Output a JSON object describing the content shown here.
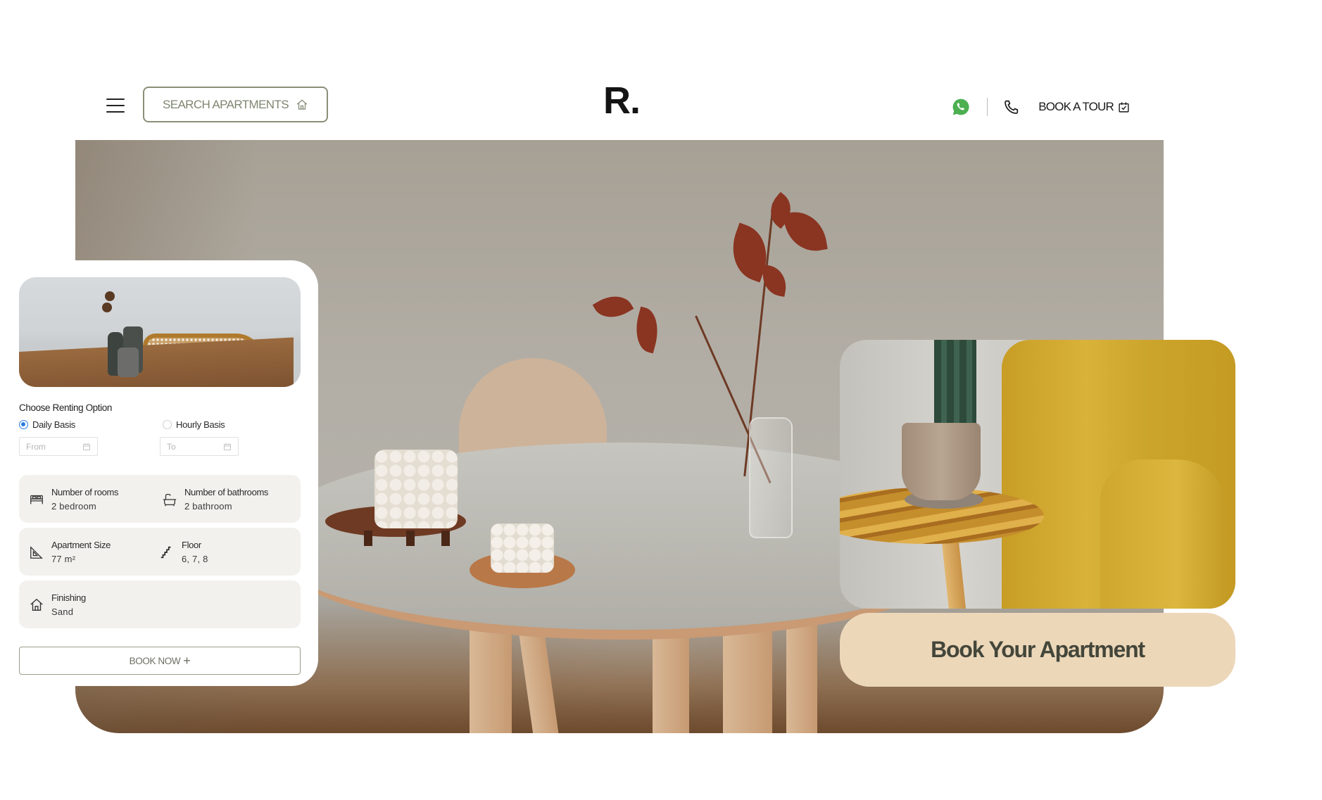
{
  "header": {
    "search_label": "SEARCH APARTMENTS",
    "logo": "R.",
    "book_tour_label": "BOOK A TOUR",
    "icons": {
      "menu": "hamburger-menu-icon",
      "search": "home-icon",
      "whatsapp": "whatsapp-icon",
      "phone": "phone-icon",
      "tour": "calendar-check-icon"
    }
  },
  "booking_card": {
    "title": "Choose Renting Option",
    "options": [
      {
        "label": "Daily Basis",
        "selected": true
      },
      {
        "label": "Hourly Basis",
        "selected": false
      }
    ],
    "from_placeholder": "From",
    "to_placeholder": "To",
    "details": [
      {
        "icon": "bed-icon",
        "label": "Number of rooms",
        "value": "2 bedroom"
      },
      {
        "icon": "bathtub-icon",
        "label": "Number of bathrooms",
        "value": "2 bathroom"
      },
      {
        "icon": "set-square-icon",
        "label": "Apartment Size",
        "value": "77 m²"
      },
      {
        "icon": "stairs-icon",
        "label": "Floor",
        "value": "6, 7, 8"
      },
      {
        "icon": "home-icon",
        "label": "Finishing",
        "value": "Sand"
      }
    ],
    "book_now_label": "BOOK NOW",
    "book_now_icon": "+"
  },
  "cta": {
    "label": "Book Your Apartment"
  },
  "colors": {
    "accent_olive": "#7f8670",
    "cta_background": "#ecd7b9",
    "cta_text": "#44463a",
    "radio_selected": "#2a7de1",
    "whatsapp_green": "#4caf50",
    "info_box_bg": "#f2f1ed"
  }
}
